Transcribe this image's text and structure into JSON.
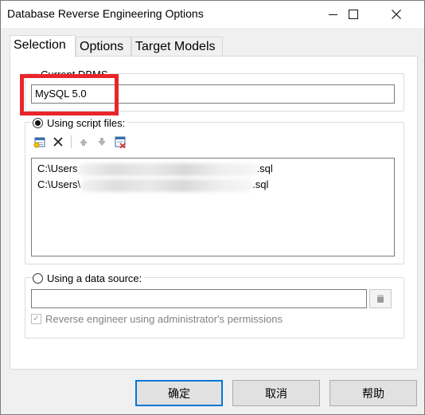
{
  "window": {
    "title": "Database Reverse Engineering Options",
    "controls": [
      "minimize-icon",
      "maximize-icon",
      "close-icon"
    ]
  },
  "tabs": [
    {
      "label": "Selection",
      "active": true
    },
    {
      "label": "Options",
      "active": false
    },
    {
      "label": "Target Models",
      "active": false
    }
  ],
  "dbms": {
    "label": "Current DBMS",
    "value": "MySQL 5.0"
  },
  "script_files": {
    "label": "Using script files:",
    "selected": true,
    "toolbar": [
      "add-file-icon",
      "delete-icon",
      "move-up-icon",
      "move-down-icon",
      "clear-list-icon"
    ],
    "files": [
      {
        "prefix": "C:\\Users",
        "suffix": ".sql"
      },
      {
        "prefix": "C:\\Users\\",
        "suffix": ".sql"
      }
    ]
  },
  "data_source": {
    "label": "Using a data source:",
    "selected": false,
    "value": "",
    "admin_checkbox_label": "Reverse engineer using administrator's permissions",
    "admin_checked": true,
    "admin_enabled": false
  },
  "buttons": {
    "ok": "确定",
    "cancel": "取消",
    "help": "帮助"
  },
  "colors": {
    "highlight": "#e8262a",
    "default_button_border": "#0078d7"
  }
}
